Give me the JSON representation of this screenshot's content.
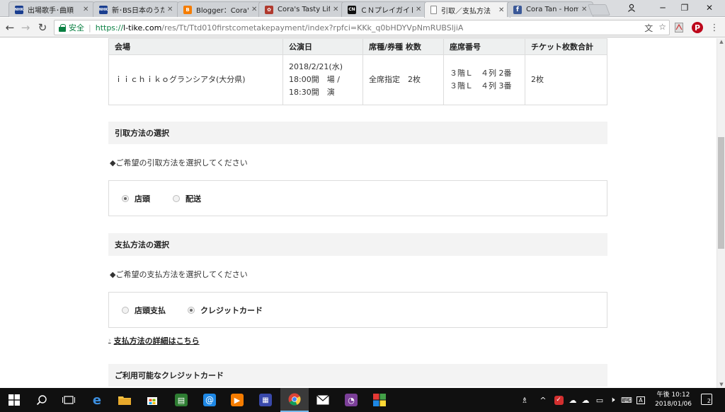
{
  "browser": {
    "tabs": [
      {
        "title": "出場歌手･曲順",
        "favicon": "nhk-icon",
        "favicon_text": "NHK",
        "favicon_color": "#1a3e8f"
      },
      {
        "title": "新･BS日本のうた",
        "favicon": "nhk-icon",
        "favicon_text": "NHK",
        "favicon_color": "#1a3e8f"
      },
      {
        "title": "Blogger：Cora's",
        "favicon": "blogger-icon",
        "favicon_text": "B",
        "favicon_color": "#f57d00"
      },
      {
        "title": "Cora's Tasty Life",
        "favicon": "cora-icon",
        "favicon_text": "✿",
        "favicon_color": "#b03a2e"
      },
      {
        "title": "ＣＮプレイガイド",
        "favicon": "cn-icon",
        "favicon_text": "CN",
        "favicon_color": "#111111"
      },
      {
        "title": "引取／支払方法",
        "favicon": "page-icon",
        "favicon_text": "",
        "favicon_color": "#ffffff"
      },
      {
        "title": "Cora Tan - Home",
        "favicon": "facebook-icon",
        "favicon_text": "f",
        "favicon_color": "#3b5998"
      }
    ],
    "security_label": "安全",
    "url_scheme": "https://",
    "url_host": "l-tike.com",
    "url_path": "/res/Tt/Ttd010firstcometakepayment/index?rpfci=KKk_q0bHDYVpNmRUBSljiA"
  },
  "ticket_table": {
    "headers": [
      "会場",
      "公演日",
      "席種/券種 枚数",
      "座席番号",
      "チケット枚数合計"
    ],
    "row": {
      "venue": "ｉｉｃｈｉｋｏグランシアタ(大分県)",
      "date": "2018/2/21(水)\n18:00開　場 /\n18:30開　演",
      "seat_type": "全席指定　2枚",
      "seat_numbers": "３階Ｌ　４列 2番\n３階Ｌ　４列 3番",
      "total": "2枚"
    }
  },
  "pickup": {
    "heading": "引取方法の選択",
    "note": "◆ご希望の引取方法を選択してください",
    "options": [
      {
        "label": "店頭",
        "selected": true
      },
      {
        "label": "配送",
        "selected": false
      }
    ]
  },
  "payment": {
    "heading": "支払方法の選択",
    "note": "◆ご希望の支払方法を選択してください",
    "options": [
      {
        "label": "店頭支払",
        "selected": false
      },
      {
        "label": "クレジットカード",
        "selected": true
      }
    ],
    "detail_link": "支払方法の詳細はこちら"
  },
  "cards": {
    "heading": "ご利用可能なクレジットカード"
  },
  "taskbar": {
    "time": "午後 10:12",
    "date": "2018/01/06",
    "notification_count": "2",
    "ime_label": "A"
  }
}
